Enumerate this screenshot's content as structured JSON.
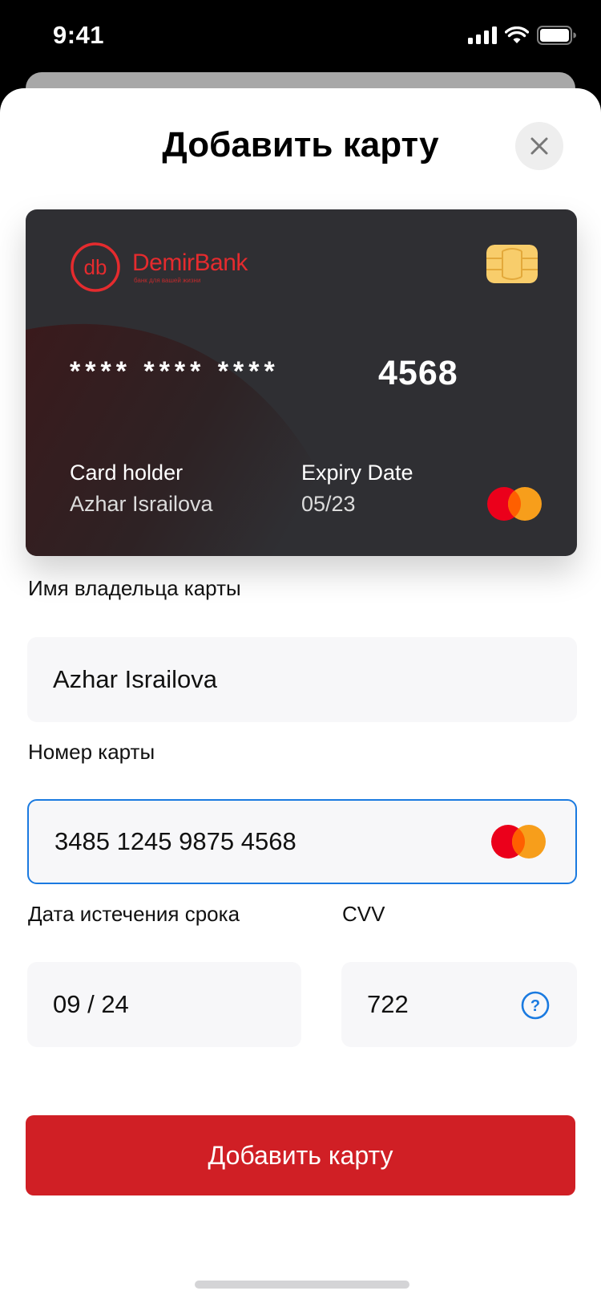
{
  "status_bar": {
    "time": "9:41"
  },
  "sheet": {
    "title": "Добавить карту"
  },
  "card": {
    "brand_name": "DemirBank",
    "brand_tagline": "банк для вашей жизни",
    "logo_mark": "db",
    "masked_number": "**** **** ****",
    "last_four": "4568",
    "holder_label": "Card holder",
    "holder_value": "Azhar Israilova",
    "expiry_label": "Expiry Date",
    "expiry_value": "05/23",
    "network_icon": "mastercard-icon"
  },
  "form": {
    "name_label": "Имя владельца карты",
    "name_value": "Azhar Israilova",
    "number_label": "Номер карты",
    "number_value": "3485 1245 9875 4568",
    "expiry_label": "Дата истечения срока",
    "expiry_value": "09 / 24",
    "cvv_label": "CVV",
    "cvv_value": "722"
  },
  "submit_label": "Добавить карту",
  "colors": {
    "brand_red": "#d01f25",
    "focus_blue": "#1a7ae0",
    "card_bg": "#2f2f33",
    "field_bg": "#f7f7f9"
  }
}
